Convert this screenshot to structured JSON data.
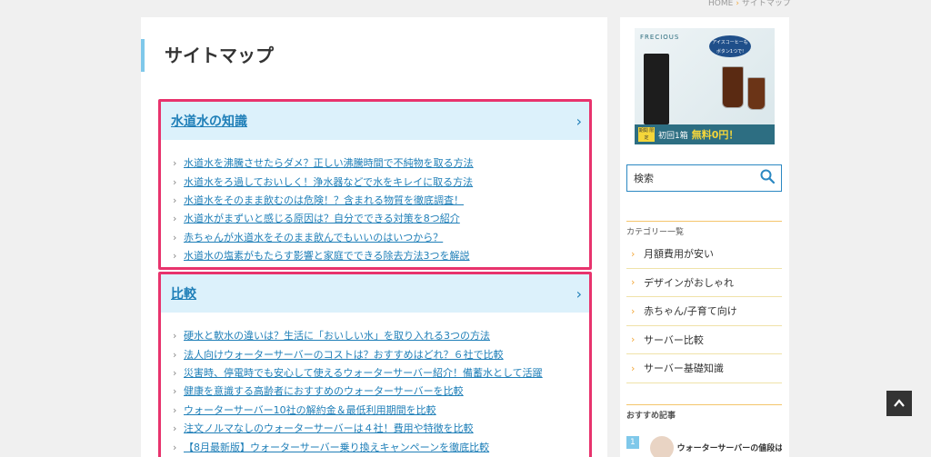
{
  "breadcrumb": {
    "home": "HOME",
    "current": "サイトマップ"
  },
  "page": {
    "title": "サイトマップ"
  },
  "sections": [
    {
      "heading": "水道水の知識",
      "links": [
        "水道水を沸騰させたらダメ？正しい沸騰時間で不純物を取る方法",
        "水道水をろ過しておいしく！浄水器などで水をキレイに取る方法",
        "水道水をそのまま飲むのは危険！？含まれる物質を徹底調査！",
        "水道水がまずいと感じる原因は？自分でできる対策を8つ紹介",
        "赤ちゃんが水道水をそのまま飲んでもいいのはいつから？",
        "水道水の塩素がもたらす影響と家庭でできる除去方法3つを解説"
      ]
    },
    {
      "heading": "比較",
      "links": [
        "硬水と軟水の違いは？生活に「おいしい水」を取り入れる3つの方法",
        "法人向けウォーターサーバーのコストは？おすすめはどれ？６社で比較",
        "災害時、停電時でも安心して使えるウォーターサーバー紹介！備蓄水として活躍",
        "健康を意識する高齢者におすすめのウォーターサーバーを比較",
        "ウォーターサーバー10社の解約金＆最低利用期間を比較",
        "注文ノルマなしのウォーターサーバーは４社！費用や特徴を比較",
        "【8月最新版】ウォーターサーバー乗り換えキャンペーンを徹底比較"
      ]
    }
  ],
  "sidebar": {
    "ad": {
      "brand": "FRECIOUS",
      "bubble": "アイスコーヒーも ボタン1つで!",
      "tag": "期間 限定",
      "offer": "初回1箱",
      "offer_free": "無料0円！"
    },
    "search": {
      "placeholder": "検索"
    },
    "categories_heading": "カテゴリー一覧",
    "categories": [
      "月額費用が安い",
      "デザインがおしゃれ",
      "赤ちゃん/子育て向け",
      "サーバー比較",
      "サーバー基礎知識"
    ],
    "recommended_heading": "おすすめ記事",
    "recommended": [
      {
        "rank": "1",
        "title": "ウォーターサーバーの値段は"
      }
    ]
  },
  "icons": {
    "chevron": "chevron-right-icon",
    "search": "search-icon",
    "to_top": "chevron-up-icon"
  },
  "colors": {
    "accent_pink": "#e8336d",
    "link_blue": "#1f7fb8",
    "header_bg": "#dcf1fb",
    "arrow_orange": "#f4a93d"
  }
}
